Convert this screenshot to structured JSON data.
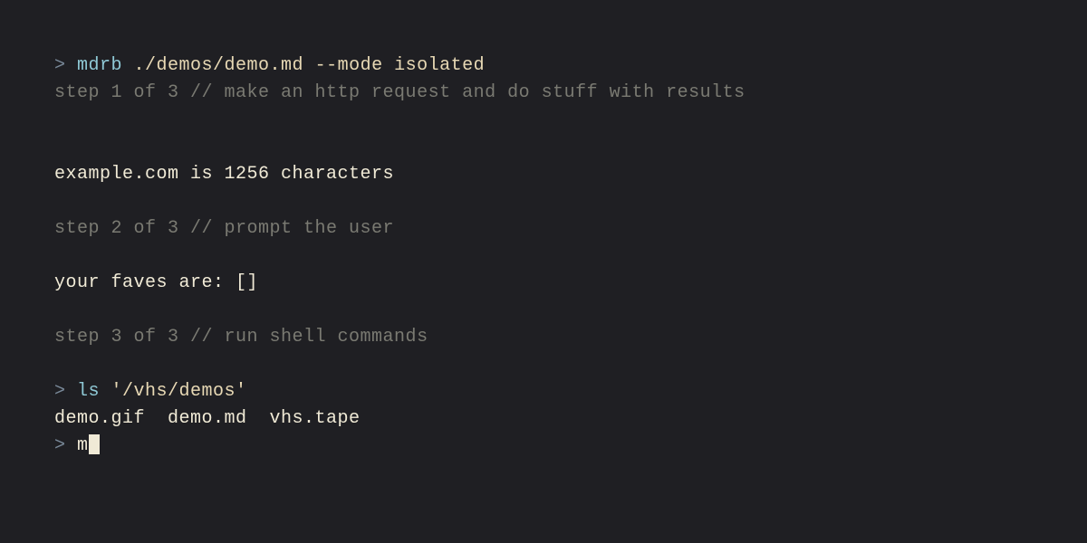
{
  "lines": {
    "cmd1": {
      "prompt": "> ",
      "name": "mdrb",
      "args": " ./demos/demo.md --mode isolated"
    },
    "step1": "step 1 of 3 // make an http request and do stuff with results",
    "out1": "example.com is 1256 characters",
    "step2": "step 2 of 3 // prompt the user",
    "out2": "your faves are: []",
    "step3": "step 3 of 3 // run shell commands",
    "cmd2": {
      "prompt": "> ",
      "name": "ls",
      "args": " '/vhs/demos'"
    },
    "out3": "demo.gif  demo.md  vhs.tape",
    "cmd3": {
      "prompt": "> ",
      "typed": "m"
    }
  }
}
